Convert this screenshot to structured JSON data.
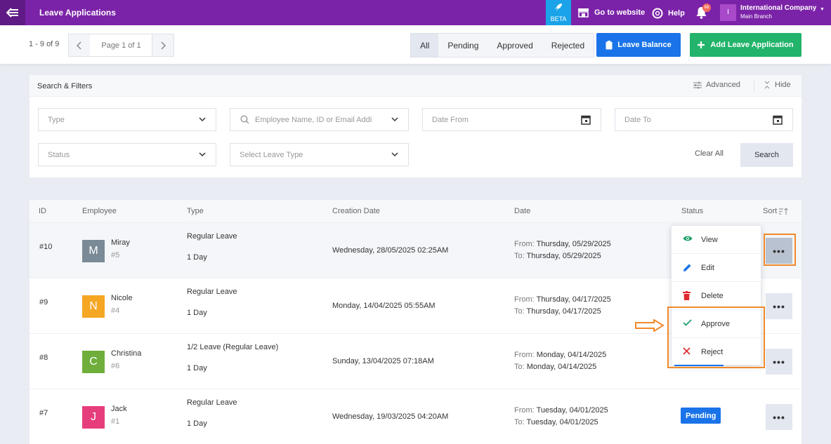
{
  "topbar": {
    "title": "Leave Applications",
    "beta": "BETA",
    "website": "Go to website",
    "help": "Help",
    "notif_count": "68",
    "avatar_letter": "I",
    "company": "International Company",
    "branch": "Main Branch"
  },
  "toolbar": {
    "count": "1 - 9 of 9",
    "page": "Page 1 of 1",
    "tabs": [
      "All",
      "Pending",
      "Approved",
      "Rejected"
    ],
    "balance_btn": "Leave Balance",
    "add_btn": "Add Leave Application"
  },
  "filters": {
    "title": "Search & Filters",
    "advanced": "Advanced",
    "hide": "Hide",
    "type_placeholder": "Type",
    "employee_placeholder": "Employee Name, ID or Email Addi",
    "date_from": "Date From",
    "date_to": "Date To",
    "status_placeholder": "Status",
    "leave_type_placeholder": "Select Leave Type",
    "clear": "Clear All",
    "search": "Search"
  },
  "table": {
    "headers": [
      "ID",
      "Employee",
      "Type",
      "Creation Date",
      "Date",
      "Status",
      "Sort"
    ],
    "from_label": "From:",
    "to_label": "To:",
    "rows": [
      {
        "id": "#10",
        "initial": "M",
        "avatar_color": "#7a8a96",
        "name": "Miray",
        "num": "#5",
        "type": "Regular Leave",
        "days": "1 Day",
        "created": "Wednesday, 28/05/2025 02:25AM",
        "from": "Thursday, 05/29/2025",
        "to": "Thursday, 05/29/2025",
        "status": ""
      },
      {
        "id": "#9",
        "initial": "N",
        "avatar_color": "#f5a623",
        "name": "Nicole",
        "num": "#4",
        "type": "Regular Leave",
        "days": "1 Day",
        "created": "Monday, 14/04/2025 05:55AM",
        "from": "Thursday, 04/17/2025",
        "to": "Thursday, 04/17/2025",
        "status": ""
      },
      {
        "id": "#8",
        "initial": "C",
        "avatar_color": "#6fae3b",
        "name": "Christina",
        "num": "#6",
        "type": "1/2 Leave (Regular Leave)",
        "days": "1 Day",
        "created": "Sunday, 13/04/2025 07:18AM",
        "from": "Monday, 04/14/2025",
        "to": "Monday, 04/14/2025",
        "status": ""
      },
      {
        "id": "#7",
        "initial": "J",
        "avatar_color": "#e63e7c",
        "name": "Jack",
        "num": "#1",
        "type": "Regular Leave",
        "days": "1 Day",
        "created": "Wednesday, 19/03/2025 04:20AM",
        "from": "Tuesday, 04/01/2025",
        "to": "Tuesday, 04/01/2025",
        "status": "Pending"
      }
    ]
  },
  "menu": {
    "items": [
      "View",
      "Edit",
      "Delete",
      "Approve",
      "Reject"
    ]
  },
  "colors": {
    "purple": "#7b23a8",
    "blue": "#1a73e8",
    "green": "#22b46a",
    "highlight": "#f08a2c"
  }
}
